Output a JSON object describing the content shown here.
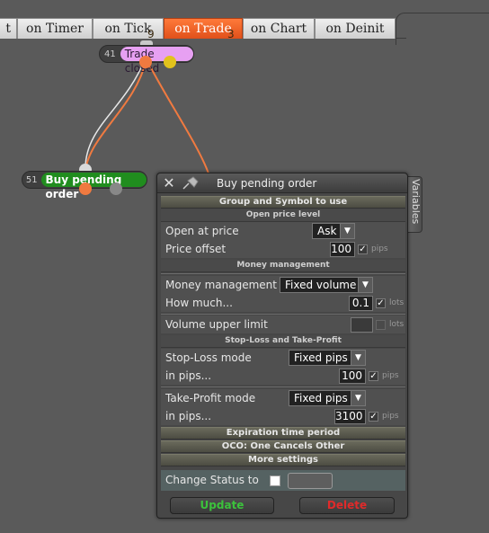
{
  "tabs": [
    {
      "label": "t"
    },
    {
      "label": "on Timer"
    },
    {
      "label": "on Tick",
      "badge": "9"
    },
    {
      "label": "on Trade",
      "badge": "3",
      "active": true
    },
    {
      "label": "on Chart"
    },
    {
      "label": "on Deinit"
    }
  ],
  "nodes": {
    "trade_closed": {
      "number": "41",
      "label": "Trade closed",
      "color": "#e7a0f2"
    },
    "buy_pending": {
      "number": "51",
      "label": "Buy pending order",
      "color": "#208d1e"
    }
  },
  "panel": {
    "title": "Buy pending order",
    "variables_tab": "Variables",
    "sections": {
      "group_symbol": "Group and Symbol to use",
      "open_price": "Open price level",
      "money_mgmt": "Money management",
      "sl_tp": "Stop-Loss and Take-Profit",
      "expiration": "Expiration time period",
      "oco": "OCO: One Cancels Other",
      "more": "More settings"
    },
    "fields": {
      "open_at_price": {
        "label": "Open at price",
        "value": "Ask"
      },
      "price_offset": {
        "label": "Price offset",
        "value": "100",
        "unit": "pips",
        "checked": true
      },
      "money_management": {
        "label": "Money management",
        "value": "Fixed volume"
      },
      "how_much": {
        "label": "How much...",
        "value": "0.1",
        "unit": "lots",
        "checked": true
      },
      "volume_upper_limit": {
        "label": "Volume upper limit",
        "value": "",
        "unit": "lots",
        "checked": false
      },
      "sl_mode": {
        "label": "Stop-Loss mode",
        "value": "Fixed pips"
      },
      "sl_pips": {
        "label": "in pips...",
        "value": "100",
        "unit": "pips",
        "checked": true
      },
      "tp_mode": {
        "label": "Take-Profit mode",
        "value": "Fixed pips"
      },
      "tp_pips": {
        "label": "in pips...",
        "value": "3100",
        "unit": "pips",
        "checked": true
      }
    },
    "change_status": {
      "label": "Change Status to",
      "checked": false
    },
    "buttons": {
      "update": "Update",
      "delete": "Delete"
    }
  },
  "colors": {
    "accent_tab": "#f06a2a",
    "wire": "#f07a40",
    "update_text": "#3cc23c",
    "delete_text": "#e02a2a"
  }
}
